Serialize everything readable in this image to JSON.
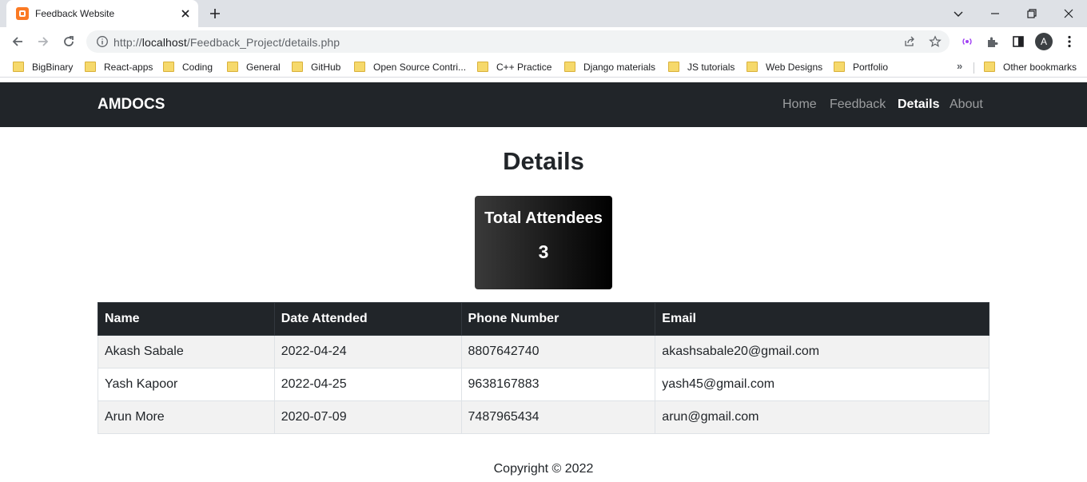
{
  "browser": {
    "tab_title": "Feedback Website",
    "url_prefix": "http://",
    "url_host": "localhost",
    "url_path": "/Feedback_Project/details.php",
    "avatar_letter": "A",
    "bookmarks": [
      "BigBinary",
      "React-apps",
      "Coding",
      "General",
      "GitHub",
      "Open Source Contri...",
      "C++ Practice",
      "Django materials",
      "JS tutorials",
      "Web Designs",
      "Portfolio"
    ],
    "other_bookmarks": "Other bookmarks",
    "overflow_label": "»"
  },
  "navbar": {
    "brand": "AMDOCS",
    "links": [
      "Home",
      "Feedback",
      "Details",
      "About"
    ],
    "active": "Details"
  },
  "page": {
    "title": "Details",
    "stat": {
      "title": "Total Attendees",
      "value": "3"
    }
  },
  "table": {
    "headers": [
      "Name",
      "Date Attended",
      "Phone Number",
      "Email"
    ],
    "rows": [
      [
        "Akash Sabale",
        "2022-04-24",
        "8807642740",
        "akashsabale20@gmail.com"
      ],
      [
        "Yash Kapoor",
        "2022-04-25",
        "9638167883",
        "yash45@gmail.com"
      ],
      [
        "Arun More",
        "2020-07-09",
        "7487965434",
        "arun@gmail.com"
      ]
    ]
  },
  "footer": {
    "copyright": "Copyright © 2022"
  },
  "colors": {
    "navbar": "#212529",
    "table_header": "#212529",
    "stripe": "#f2f2f2",
    "tab_strip": "#dee1e6"
  }
}
